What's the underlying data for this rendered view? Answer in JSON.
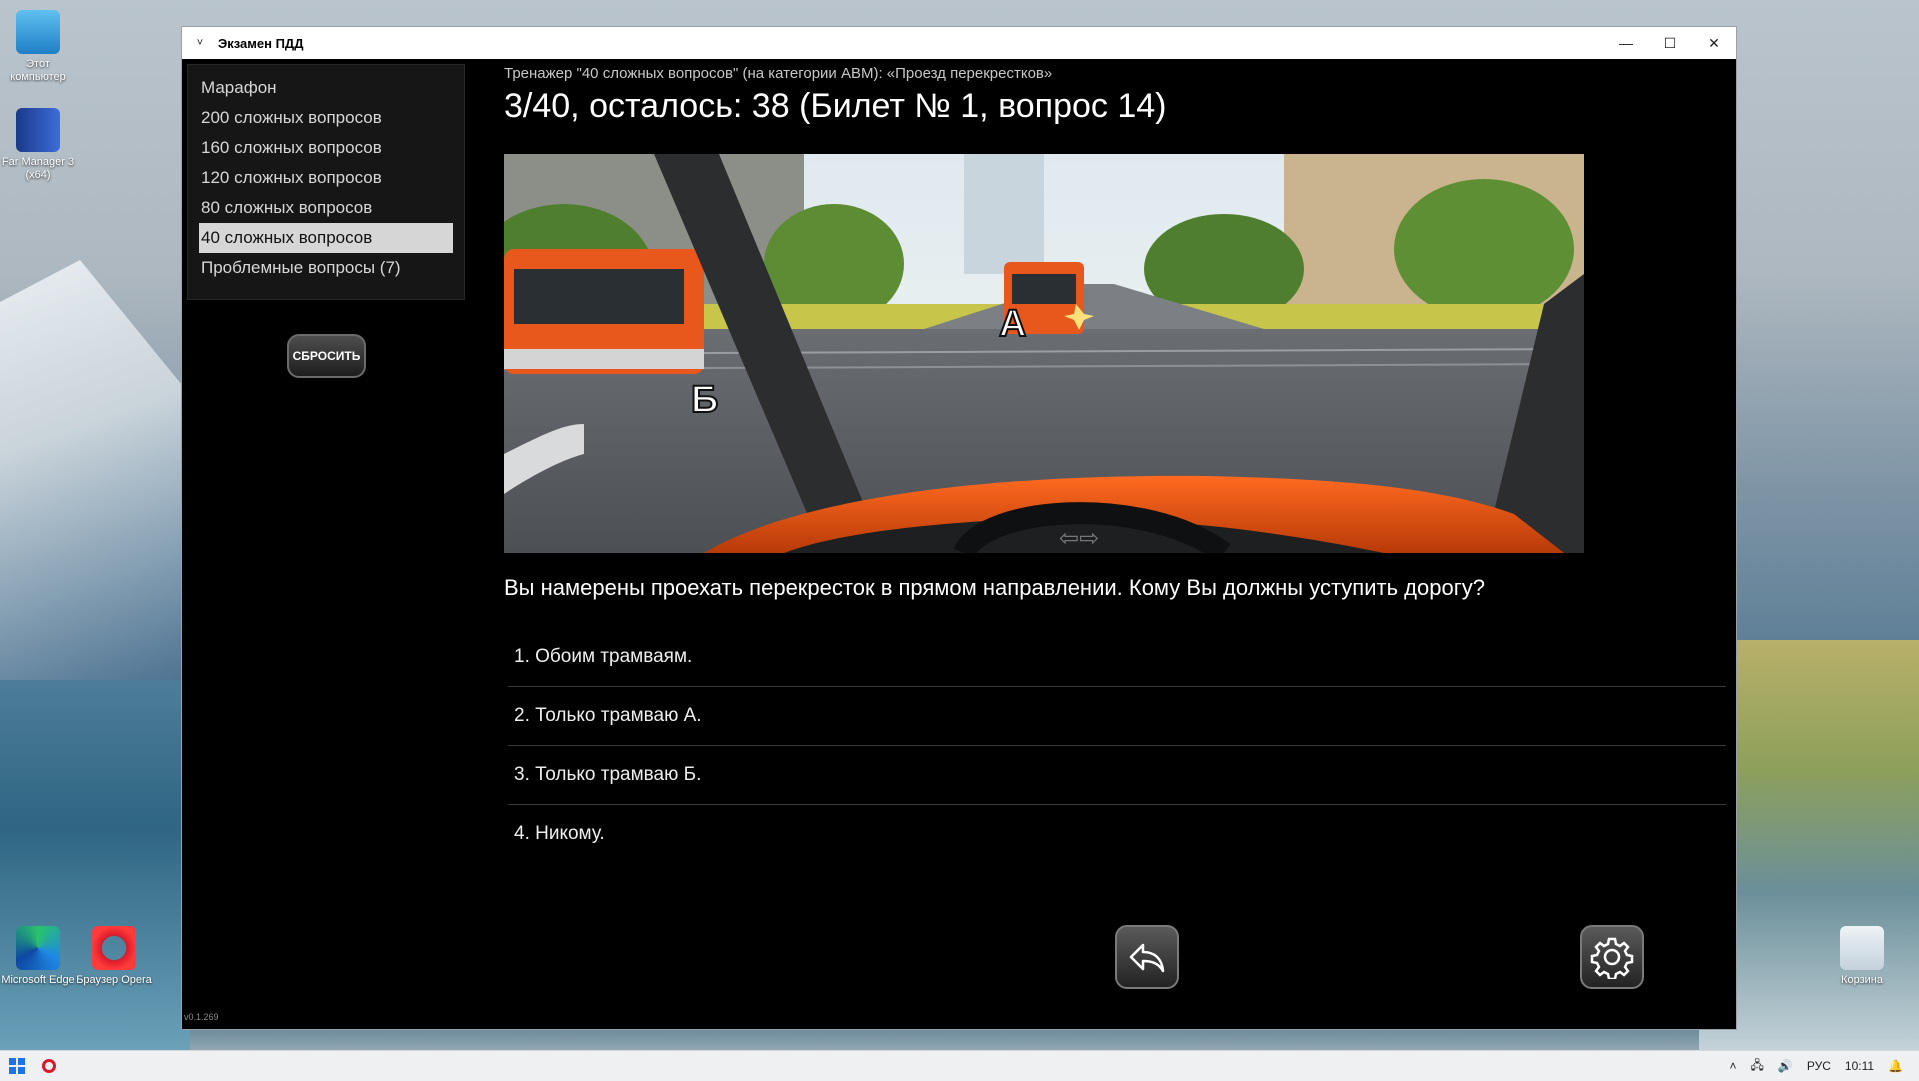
{
  "desktop": {
    "icons": [
      {
        "label": "Этот компьютер"
      },
      {
        "label": "Far Manager 3 (x64)"
      },
      {
        "label": "Microsoft Edge"
      },
      {
        "label": "Браузер Opera"
      },
      {
        "label": "Корзина"
      }
    ]
  },
  "window": {
    "title": "Экзамен ПДД",
    "menu_glyph": "˅",
    "minimize": "—",
    "maximize": "☐",
    "close": "✕"
  },
  "sidebar": {
    "items": [
      {
        "label": "Марафон"
      },
      {
        "label": "200 сложных вопросов"
      },
      {
        "label": "160 сложных вопросов"
      },
      {
        "label": "120 сложных вопросов"
      },
      {
        "label": "80 сложных вопросов"
      },
      {
        "label": "40 сложных вопросов"
      },
      {
        "label": "Проблемные вопросы (7)"
      }
    ],
    "active_index": 5,
    "reset_label": "СБРОСИТЬ"
  },
  "main": {
    "subtitle": "Тренажер \"40 сложных вопросов\" (на категории ABM): «Проезд перекрестков»",
    "counter": "3/40, осталось: 38 (Билет № 1, вопрос 14)",
    "scene": {
      "label_a": "А",
      "label_b": "Б"
    },
    "question": "Вы намерены проехать перекресток в прямом направлении. Кому Вы должны уступить дорогу?",
    "answers": [
      {
        "text": "1. Обоим трамваям."
      },
      {
        "text": "2. Только трамваю А."
      },
      {
        "text": "3. Только трамваю Б."
      },
      {
        "text": "4. Никому."
      }
    ]
  },
  "footer": {
    "back_icon": "back-arrow-icon",
    "settings_icon": "gear-icon",
    "version": "v0.1.269"
  },
  "taskbar": {
    "lang": "РУС",
    "time": "10:11"
  }
}
